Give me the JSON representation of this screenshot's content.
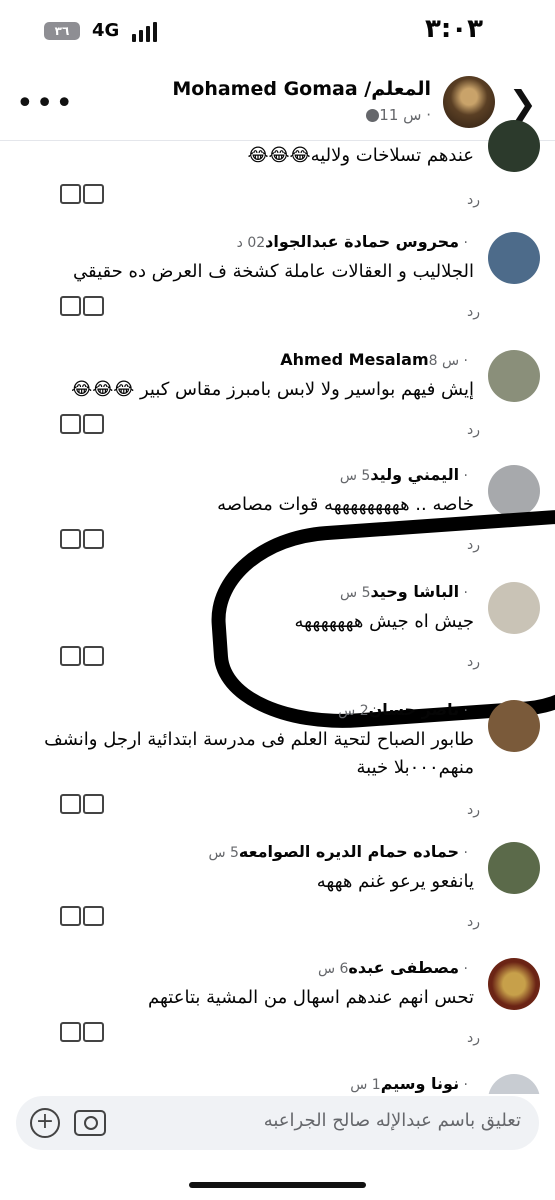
{
  "status": {
    "time": "٣:٠٣",
    "battery": "٣٦",
    "network": "4G"
  },
  "header": {
    "name": "Mohamed Gomaa /المعلم",
    "meta": "11 س ·"
  },
  "comments": [
    {
      "name": "",
      "time": "",
      "text": "عندهم تسلاخات ولاليه😂😂😂",
      "reply": "رد"
    },
    {
      "name": "محروس حمادة عبدالجواد",
      "time": "02 د ·",
      "text": "الجلاليب و العقالات عاملة كشخة ف العرض ده حقيقي",
      "reply": "رد"
    },
    {
      "name": "Ahmed Mesalam",
      "time": "8 س ·",
      "text": "إيش فيهم بواسير ولا لابس بامبرز مقاس كبير 😂😂😂",
      "reply": "رد"
    },
    {
      "name": "اليمني وليد",
      "time": "5 س ·",
      "text": "خاصه .. هههههههههه قوات مصاصه",
      "reply": "رد"
    },
    {
      "name": "الباشا وحيد",
      "time": "5 س ·",
      "text": "جيش اه جيش هههههههه",
      "reply": "رد"
    },
    {
      "name": "ناصر حسان",
      "time": "2 س ·",
      "text": "طابور الصباح لتحية العلم فى مدرسة ابتدائية ارجل وانشف منهم٠٠٠بلا خيبة",
      "reply": "رد"
    },
    {
      "name": "حماده حمام الديره الصوامعه",
      "time": "5 س ·",
      "text": "يانفعو يرعو غنم هههه",
      "reply": "رد"
    },
    {
      "name": "مصطفى عبده",
      "time": "6 س ·",
      "text": "تحس انهم عندهم اسهال من المشية بتاعتهم",
      "reply": "رد"
    },
    {
      "name": "نونا وسيم",
      "time": "1 س ·",
      "text": "",
      "reply": ""
    }
  ],
  "composer": {
    "placeholder": "تعليق باسم عبدالإله صالح الجراعبه"
  }
}
